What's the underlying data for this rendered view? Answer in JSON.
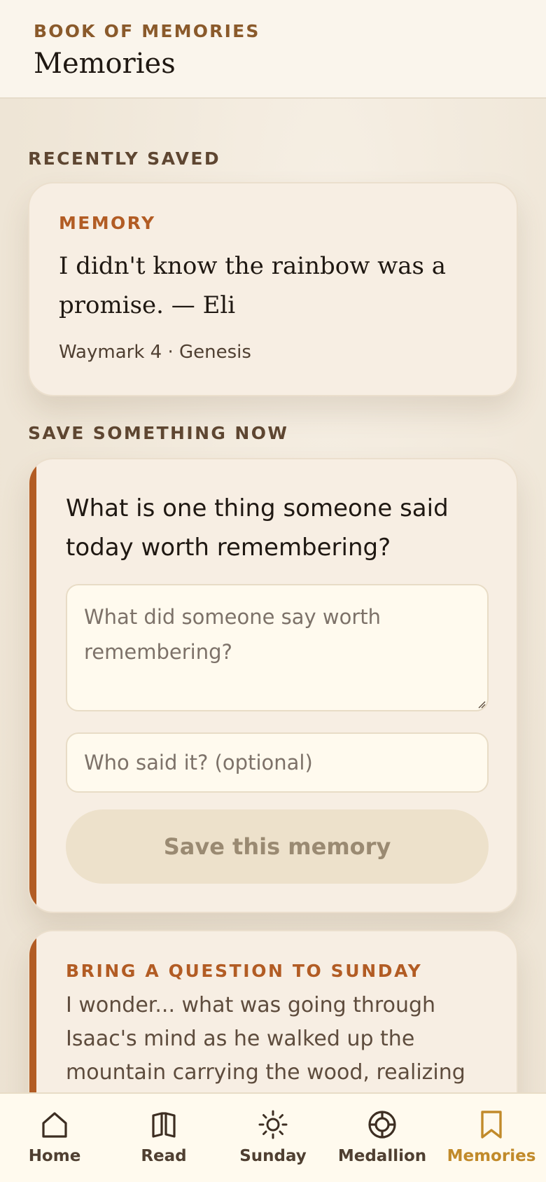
{
  "header": {
    "eyebrow": "BOOK OF MEMORIES",
    "title": "Memories"
  },
  "recent": {
    "section_label": "RECENTLY SAVED",
    "tag": "MEMORY",
    "quote": "I didn't know the rainbow was a promise. — Eli",
    "meta": "Waymark 4 · Genesis"
  },
  "save": {
    "section_label": "SAVE SOMETHING NOW",
    "prompt": "What is one thing someone said today worth remembering?",
    "memory_value": "",
    "memory_placeholder": "What did someone say worth remembering?",
    "speaker_value": "",
    "speaker_placeholder": "Who said it? (optional)",
    "button_label": "Save this memory"
  },
  "question": {
    "tag": "BRING A QUESTION TO SUNDAY",
    "text": "I wonder... what was going through Isaac's mind as he walked up the mountain carrying the wood, realizing"
  },
  "nav": {
    "items": [
      {
        "label": "Home",
        "icon": "home-icon",
        "active": false
      },
      {
        "label": "Read",
        "icon": "book-icon",
        "active": false
      },
      {
        "label": "Sunday",
        "icon": "sun-icon",
        "active": false
      },
      {
        "label": "Medallion",
        "icon": "medallion-icon",
        "active": false
      },
      {
        "label": "Memories",
        "icon": "bookmark-icon",
        "active": true
      }
    ]
  },
  "colors": {
    "accent": "#b25c24",
    "active_nav": "#c18a2a",
    "background": "#f1e9dc"
  }
}
